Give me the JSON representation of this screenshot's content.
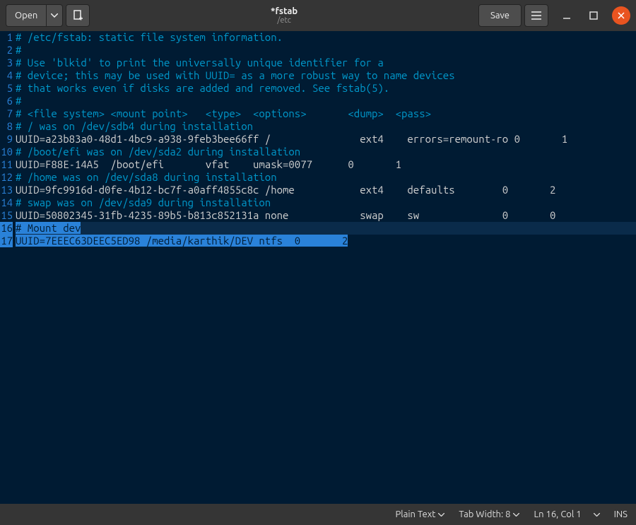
{
  "header": {
    "open_label": "Open",
    "save_label": "Save",
    "title": "*fstab",
    "subtitle": "/etc"
  },
  "editor": {
    "lines": [
      {
        "n": 1,
        "text": "# /etc/fstab: static file system information.",
        "cls": "comment"
      },
      {
        "n": 2,
        "text": "#",
        "cls": "comment"
      },
      {
        "n": 3,
        "text": "# Use 'blkid' to print the universally unique identifier for a",
        "cls": "comment"
      },
      {
        "n": 4,
        "text": "# device; this may be used with UUID= as a more robust way to name devices",
        "cls": "comment"
      },
      {
        "n": 5,
        "text": "# that works even if disks are added and removed. See fstab(5).",
        "cls": "comment"
      },
      {
        "n": 6,
        "text": "#",
        "cls": "comment"
      },
      {
        "n": 7,
        "text": "# <file system> <mount point>   <type>  <options>       <dump>  <pass>",
        "cls": "comment"
      },
      {
        "n": 8,
        "text": "# / was on /dev/sdb4 during installation",
        "cls": "comment"
      },
      {
        "n": 9,
        "text": "UUID=a23b83a0-48d1-4bc9-a938-9feb3bee66ff /               ext4    errors=remount-ro 0       1",
        "cls": ""
      },
      {
        "n": 10,
        "text": "# /boot/efi was on /dev/sda2 during installation",
        "cls": "comment"
      },
      {
        "n": 11,
        "text": "UUID=F88E-14A5  /boot/efi       vfat    umask=0077      0       1",
        "cls": ""
      },
      {
        "n": 12,
        "text": "# /home was on /dev/sda8 during installation",
        "cls": "comment"
      },
      {
        "n": 13,
        "text": "UUID=9fc9916d-d0fe-4b12-bc7f-a0aff4855c8c /home           ext4    defaults        0       2",
        "cls": ""
      },
      {
        "n": 14,
        "text": "# swap was on /dev/sda9 during installation",
        "cls": "comment"
      },
      {
        "n": 15,
        "text": "UUID=50802345-31fb-4235-89b5-b813c852131a none            swap    sw              0       0",
        "cls": ""
      },
      {
        "n": 16,
        "text": "# Mount dev",
        "cls": "comment",
        "selected": true,
        "selfull": true
      },
      {
        "n": 17,
        "text": "UUID=7EEEC63DEEC5ED98 /media/karthik/DEV ntfs  0       2",
        "cls": "",
        "selected": true,
        "selfull": false
      }
    ]
  },
  "statusbar": {
    "syntax": "Plain Text",
    "tab_width": "Tab Width: 8",
    "position": "Ln 16, Col 1",
    "mode": "INS"
  }
}
